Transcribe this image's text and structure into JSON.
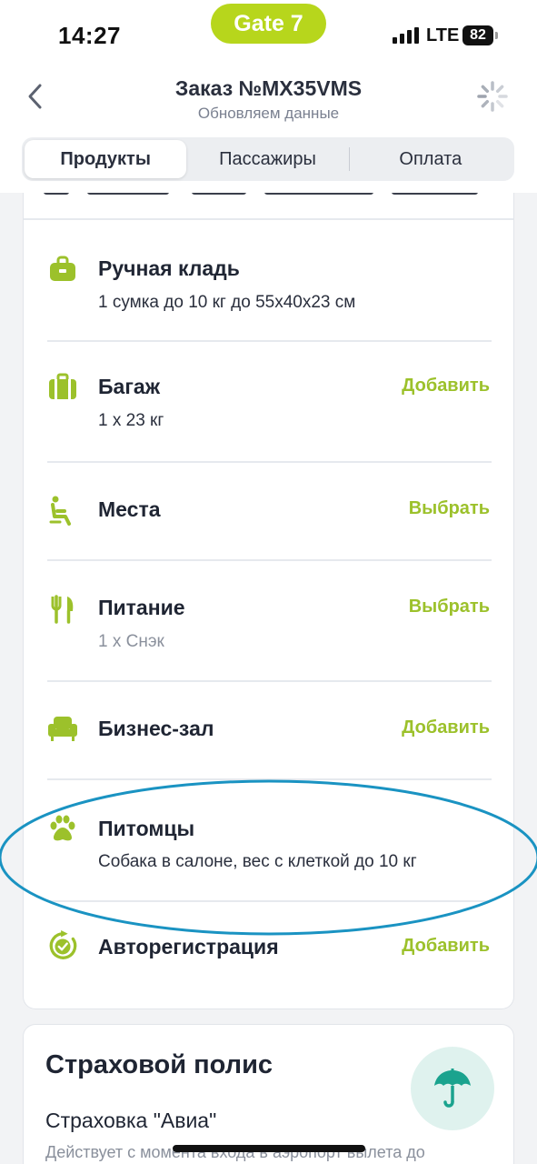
{
  "status_bar": {
    "time": "14:27",
    "gate_pill": "Gate 7",
    "network": "LTE",
    "battery": "82"
  },
  "header": {
    "title": "Заказ №MX35VMS",
    "subtitle": "Обновляем данные",
    "back_icon": "chevron-left-icon",
    "loading_icon": "spinner-icon"
  },
  "tabs": [
    {
      "label": "Продукты",
      "active": true
    },
    {
      "label": "Пассажиры",
      "active": false
    },
    {
      "label": "Оплата",
      "active": false
    }
  ],
  "products": {
    "items": [
      {
        "icon": "hand-luggage-icon",
        "title": "Ручная кладь",
        "subtitle": "1 сумка до 10 кг до 55х40х23 см",
        "action": ""
      },
      {
        "icon": "suitcase-icon",
        "title": "Багаж",
        "subtitle": "1 х 23 кг",
        "action": "Добавить"
      },
      {
        "icon": "seat-icon",
        "title": "Места",
        "subtitle": "",
        "action": "Выбрать"
      },
      {
        "icon": "meal-icon",
        "title": "Питание",
        "subtitle": "1 х Снэк",
        "action": "Выбрать"
      },
      {
        "icon": "armchair-icon",
        "title": "Бизнес-зал",
        "subtitle": "",
        "action": "Добавить"
      },
      {
        "icon": "paw-icon",
        "title": "Питомцы",
        "subtitle": "Собака в салоне, вес с клеткой до 10 кг",
        "action": ""
      },
      {
        "icon": "auto-checkin-icon",
        "title": "Авторегистрация",
        "subtitle": "",
        "action": "Добавить"
      }
    ]
  },
  "insurance": {
    "title": "Страховой полис",
    "name": "Страховка \"Авиа\"",
    "description": "Действует с момента входа в аэропорт вылета до",
    "icon": "umbrella-icon"
  },
  "colors": {
    "accent_green": "#9cc12b",
    "gate_pill": "#b7d61c",
    "highlight_ellipse": "#1a93c2",
    "umbrella": "#1aa38e"
  }
}
